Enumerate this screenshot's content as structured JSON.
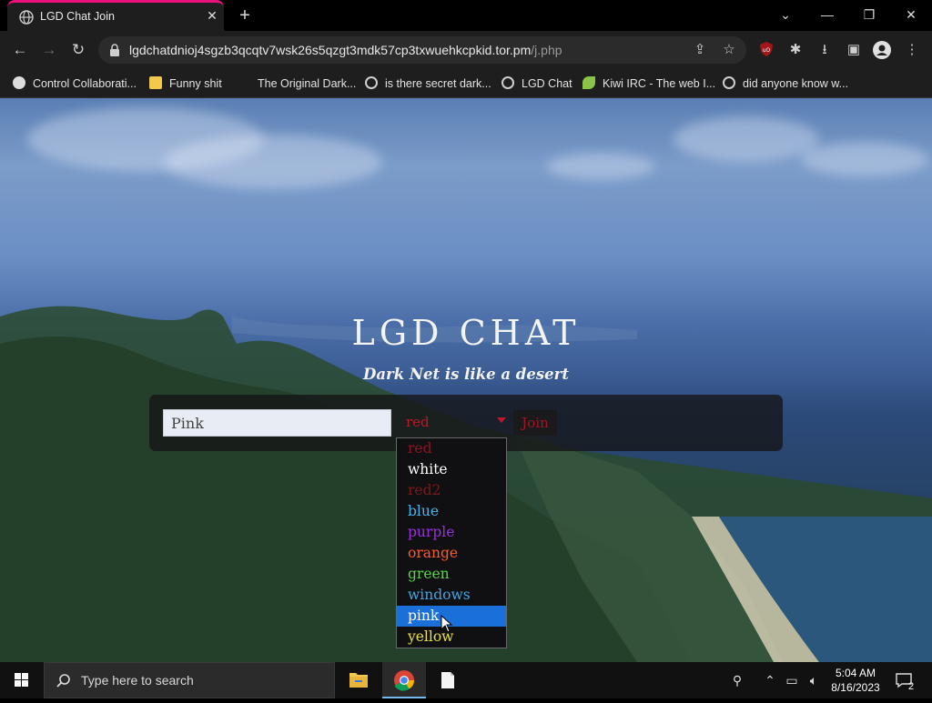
{
  "browser": {
    "tab_title": "LGD Chat Join",
    "tab_close": "✕",
    "new_tab": "+",
    "url_host": "lgdchatdnioj4sgzb3qcqtv7wsk26s5qzgt3mdk57cp3txwuehkcpkid.tor.pm",
    "url_path": "/j.php",
    "accent": "#e8107a"
  },
  "bookmarks": [
    {
      "label": "Control Collaborati...",
      "icon": "github-icon"
    },
    {
      "label": "Funny shit",
      "icon": "folder-icon"
    },
    {
      "label": "The Original Dark...",
      "icon": "blank-icon"
    },
    {
      "label": "is there secret dark...",
      "icon": "globe-icon"
    },
    {
      "label": "LGD Chat",
      "icon": "globe-icon"
    },
    {
      "label": "Kiwi IRC - The web I...",
      "icon": "kiwi-icon"
    },
    {
      "label": "did anyone know w...",
      "icon": "globe-icon"
    }
  ],
  "page": {
    "title": "LGD CHAT",
    "subtitle": "Dark Net is like a desert",
    "nickname_value": "Pink",
    "color_selected": "red",
    "join_label": "Join"
  },
  "color_options": [
    {
      "label": "red",
      "color": "#8b1420",
      "selected": false
    },
    {
      "label": "white",
      "color": "#ffffff",
      "selected": false
    },
    {
      "label": "red2",
      "color": "#7a1a1a",
      "selected": false
    },
    {
      "label": "blue",
      "color": "#4fb3e8",
      "selected": false
    },
    {
      "label": "purple",
      "color": "#9b30e0",
      "selected": false
    },
    {
      "label": "orange",
      "color": "#ff5a2a",
      "selected": false
    },
    {
      "label": "green",
      "color": "#5cd44a",
      "selected": false
    },
    {
      "label": "windows",
      "color": "#3fa6e6",
      "selected": false
    },
    {
      "label": "pink",
      "color": "#ffffff",
      "selected": true
    },
    {
      "label": "yellow",
      "color": "#e8e040",
      "selected": false
    }
  ],
  "taskbar": {
    "search_placeholder": "Type here to search",
    "time": "5:04 AM",
    "date": "8/16/2023",
    "notification_count": "2"
  }
}
